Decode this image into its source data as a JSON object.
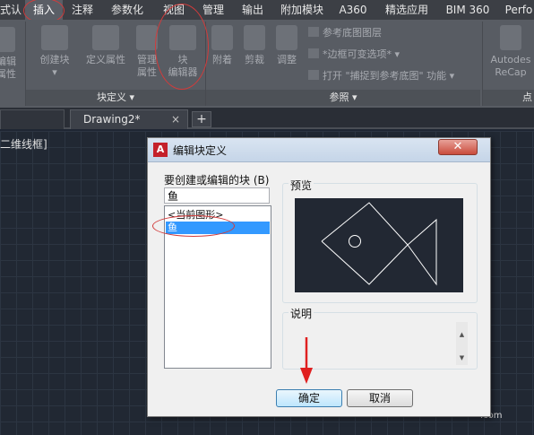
{
  "menubar": {
    "items": [
      "式认",
      "插入",
      "注释",
      "参数化",
      "视图",
      "管理",
      "输出",
      "附加模块",
      "A360",
      "精选应用",
      "BIM 360",
      "Perfo"
    ]
  },
  "ribbon": {
    "left_partial_labels": [
      "编辑",
      "属性"
    ],
    "block_group": {
      "title": "块定义 ▾",
      "create_block": "创建块",
      "define_attributes": "定义属性",
      "manage_attributes": [
        "管理",
        "属性"
      ],
      "block_editor": [
        "块",
        "编辑器"
      ]
    },
    "reference_group": {
      "title": "参照",
      "attach": "附着",
      "clip": "剪裁",
      "adjust": "调整",
      "underlay_layers": "参考底图图层",
      "frames_vary": "*边框可变选项*",
      "snap_to_underlays": "打开 \"捕捉到参考底图\" 功能"
    },
    "right_partial_labels": [
      "Autodes",
      "ReCap"
    ],
    "point_group_title": "点"
  },
  "tabs": {
    "active_tab": "Drawing2*",
    "close_glyph": "×",
    "add_glyph": "+"
  },
  "canvas": {
    "viewport_label": "二维线框]",
    "watermark": ".com"
  },
  "dialog": {
    "title": "编辑块定义",
    "app_icon_letter": "A",
    "close_glyph": "✕",
    "block_name_label": "要创建或编辑的块 (B)",
    "block_name_value": "鱼",
    "list_items": [
      "<当前图形>",
      "鱼"
    ],
    "selected_index": 1,
    "preview_label": "预览",
    "description_label": "说明",
    "ok_button": "确定",
    "cancel_button": "取消"
  },
  "colors": {
    "annotation_red": "#d23b3b",
    "selection_blue": "#3399ff",
    "canvas_bg": "#212833"
  }
}
